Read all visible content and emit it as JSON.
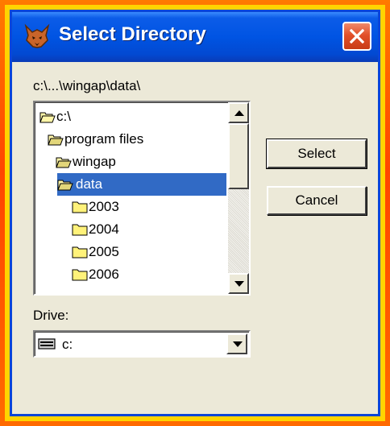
{
  "window": {
    "title": "Select Directory",
    "title_icon": "fox-app-icon",
    "close_icon": "close-icon"
  },
  "path_label": "c:\\...\\wingap\\data\\",
  "directory_list": {
    "items": [
      {
        "label": "c:\\",
        "icon": "open-folder-icon",
        "selected": false
      },
      {
        "label": "program files",
        "icon": "open-folder-icon",
        "selected": false
      },
      {
        "label": "wingap",
        "icon": "open-folder-icon",
        "selected": false
      },
      {
        "label": "data",
        "icon": "open-folder-icon",
        "selected": true
      },
      {
        "label": "2003",
        "icon": "closed-folder-icon",
        "selected": false
      },
      {
        "label": "2004",
        "icon": "closed-folder-icon",
        "selected": false
      },
      {
        "label": "2005",
        "icon": "closed-folder-icon",
        "selected": false
      },
      {
        "label": "2006",
        "icon": "closed-folder-icon",
        "selected": false
      }
    ]
  },
  "buttons": {
    "select": "Select",
    "cancel": "Cancel"
  },
  "drive": {
    "label": "Drive:",
    "value": "c:",
    "icon": "drive-icon"
  },
  "colors": {
    "title_bar": "#0054e3",
    "selection": "#316ac5",
    "dialog_bg": "#ece9d8",
    "close_button": "#e2502a"
  }
}
